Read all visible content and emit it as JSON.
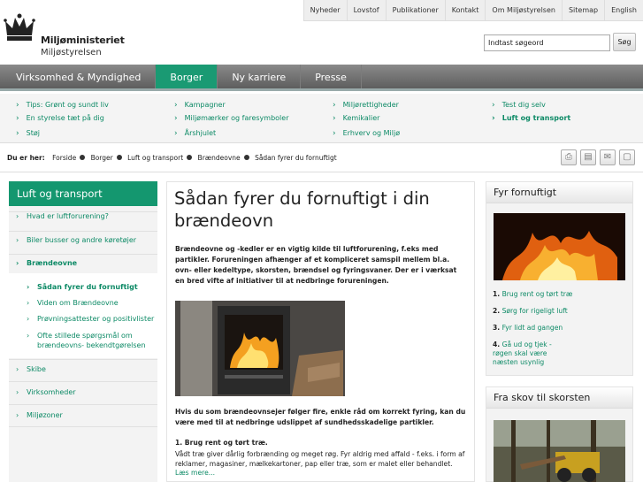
{
  "util_links": [
    "Nyheder",
    "Lovstof",
    "Publikationer",
    "Kontakt",
    "Om Miljøstyrelsen",
    "Sitemap",
    "English"
  ],
  "logo": {
    "line1": "Miljøministeriet",
    "line2": "Miljøstyrelsen"
  },
  "search": {
    "placeholder": "Indtast søgeord",
    "button": "Søg"
  },
  "nav": {
    "tabs": [
      "Virksomhed & Myndighed",
      "Borger",
      "Ny karriere",
      "Presse"
    ],
    "active": "Borger"
  },
  "subnav": {
    "col1": [
      "Tips: Grønt og sundt liv",
      "En styrelse tæt på dig",
      "Støj"
    ],
    "col2": [
      "Kampagner",
      "Miljømærker og faresymboler",
      "Årshjulet"
    ],
    "col3": [
      "Miljørettigheder",
      "Kemikalier",
      "Erhverv og Miljø"
    ],
    "col4": [
      "Test dig selv",
      "Luft og transport"
    ]
  },
  "breadcrumb": {
    "label": "Du er her:",
    "items": [
      "Forside",
      "Borger",
      "Luft og transport",
      "Brændeovne",
      "Sådan fyrer du fornuftigt"
    ]
  },
  "sidebar": {
    "title": "Luft og transport",
    "items": [
      "Hvad er luftforurening?",
      "Biler busser og andre køretøjer",
      "Brændeovne"
    ],
    "subitems": [
      "Sådan fyrer du fornuftigt",
      "Viden om Brændeovne",
      "Prøvningsattester og positivlister",
      "Ofte stillede spørgsmål om brændeovns- bekendtgørelsen"
    ],
    "items_after": [
      "Skibe",
      "Virksomheder",
      "Miljøzoner"
    ]
  },
  "main": {
    "title": "Sådan fyrer du fornuftigt i din brændeovn",
    "lead": "Brændeovne og -kedler er en vigtig kilde til luftforurening, f.eks med partikler. Forureningen afhænger af et kompliceret samspil mellem bl.a. ovn- eller kedeltype, skorsten, brændsel og fyringsvaner. Der er i værksat en bred vifte af initiativer til at nedbringe forureningen.",
    "p2": "Hvis du som brændeovnsejer følger fire, enkle råd om korrekt fyring, kan du være med til at nedbringe udslippet af sundhedsskadelige partikler.",
    "p3_heading": "1.  Brug rent og tørt træ.",
    "p3": "Vådt træ giver dårlig forbrænding og meget røg. Fyr aldrig med affald - f.eks. i form af reklamer, magasiner, mælkekartoner, pap eller træ, som er malet eller behandlet.",
    "more": "Læs mere..."
  },
  "right1": {
    "title": "Fyr fornuftigt",
    "links": [
      {
        "n": "1.",
        "t": "Brug rent og tørt træ"
      },
      {
        "n": "2.",
        "t": "Sørg for rigeligt luft"
      },
      {
        "n": "3.",
        "t": "Fyr lidt ad gangen"
      },
      {
        "n": "4.",
        "t": "Gå ud og tjek - røgen skal være næsten usynlig"
      }
    ]
  },
  "right2": {
    "title": "Fra skov til skorsten"
  },
  "colors": {
    "accent": "#14976f",
    "link": "#0d8a66",
    "nav": "#6e6e6e"
  }
}
